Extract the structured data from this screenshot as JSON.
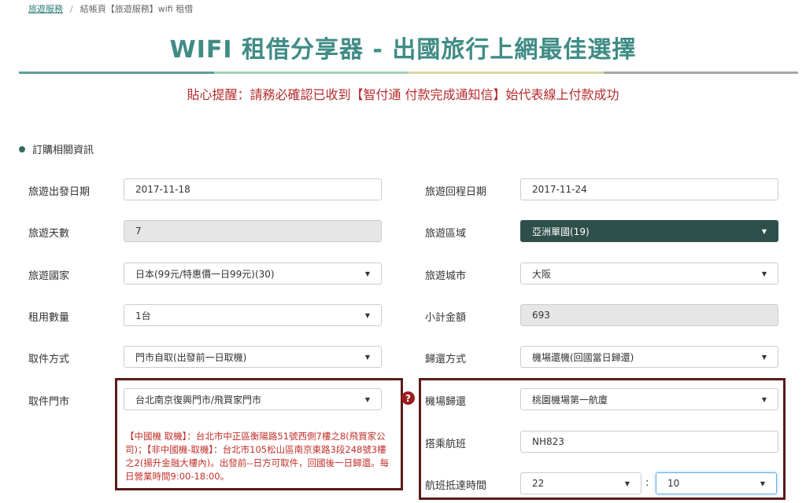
{
  "breadcrumb": {
    "home": "旅遊服務",
    "separator": "/",
    "current": "結帳頁【旅遊服務】wifi 租借"
  },
  "title": "WIFI 租借分享器 - 出國旅行上網最佳選擇",
  "rule_colors": [
    "#5c9e95",
    "#a8cdb8",
    "#d9d8a3",
    "#a7a7a7"
  ],
  "notice": "貼心提醒：請務必確認已收到【智付通 付款完成通知信】始代表線上付款成功",
  "section_title": "訂購相關資訊",
  "form": {
    "depart_date": {
      "label": "旅遊出發日期",
      "value": "2017-11-18"
    },
    "return_date": {
      "label": "旅遊回程日期",
      "value": "2017-11-24"
    },
    "days": {
      "label": "旅遊天數",
      "value": "7"
    },
    "region": {
      "label": "旅遊區域",
      "value": "亞洲單國(19)"
    },
    "country": {
      "label": "旅遊國家",
      "value": "日本(99元/特惠價一日99元)(30)"
    },
    "city": {
      "label": "旅遊城市",
      "value": "大阪"
    },
    "quantity": {
      "label": "租用數量",
      "value": "1台"
    },
    "subtotal": {
      "label": "小計金額",
      "value": "693"
    },
    "pickup_method": {
      "label": "取件方式",
      "value": "門市自取(出發前一日取機)"
    },
    "return_method": {
      "label": "歸還方式",
      "value": "機場還機(回國當日歸還)"
    },
    "pickup_store": {
      "label": "取件門市",
      "value": "台北南京復興門市/飛買家門市"
    },
    "airport_return": {
      "label": "機場歸還",
      "value": "桃園機場第一航廈"
    },
    "flight": {
      "label": "搭乘航班",
      "value": "NH823"
    },
    "arrival_time": {
      "label": "航班抵達時間",
      "hour": "22",
      "separator": ":",
      "minute": "10"
    }
  },
  "store_info": "【中國機 取機】：台北市中正區衡陽路51號西側7樓之8(飛買家公司)；【非中國機-取機】：台北市105松山區南京東路3段248號3樓之2(揚升金融大樓內)。出發前--日方可取件，回國後一日歸還。每日營業時間9:00-18:00。",
  "help_icon": "?",
  "caret_icon": "▼"
}
